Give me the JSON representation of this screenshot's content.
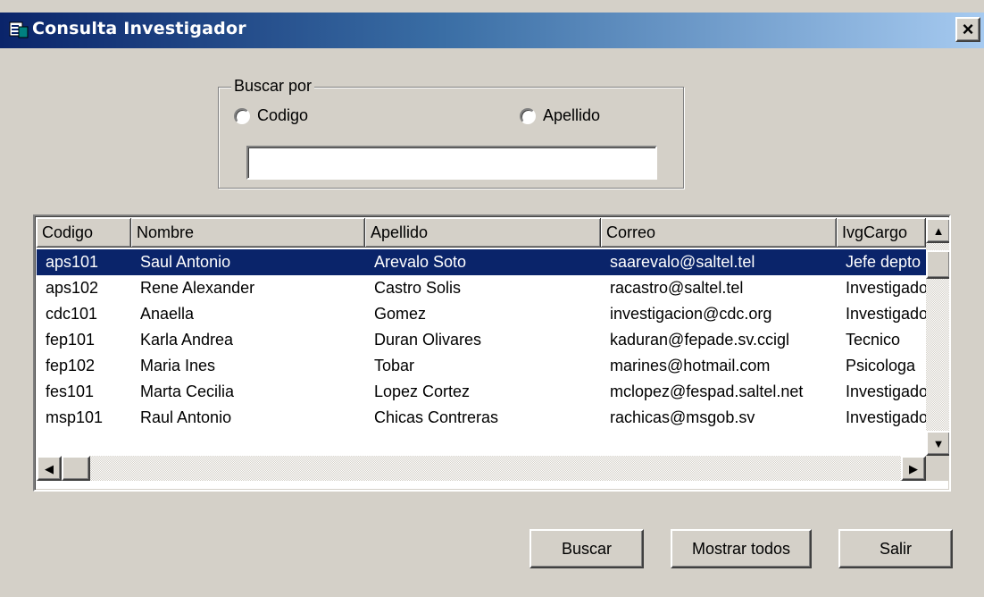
{
  "window": {
    "title": "Consulta Investigador",
    "icon": "app-window-icon",
    "close_glyph": "×"
  },
  "search": {
    "group_label": "Buscar por",
    "radio_codigo": "Codigo",
    "radio_apellido": "Apellido",
    "input_value": "",
    "input_placeholder": ""
  },
  "grid": {
    "columns": [
      "Codigo",
      "Nombre",
      "Apellido",
      "Correo",
      "IvgCargo"
    ],
    "rows": [
      {
        "codigo": "aps101",
        "nombre": "Saul Antonio",
        "apellido": "Arevalo Soto",
        "correo": "saarevalo@saltel.tel",
        "cargo": "Jefe depto"
      },
      {
        "codigo": "aps102",
        "nombre": "Rene Alexander",
        "apellido": "Castro Solis",
        "correo": "racastro@saltel.tel",
        "cargo": "Investigador"
      },
      {
        "codigo": "cdc101",
        "nombre": "Anaella",
        "apellido": "Gomez",
        "correo": "investigacion@cdc.org",
        "cargo": "Investigador"
      },
      {
        "codigo": "fep101",
        "nombre": "Karla Andrea",
        "apellido": "Duran Olivares",
        "correo": "kaduran@fepade.sv.ccigl",
        "cargo": "Tecnico"
      },
      {
        "codigo": "fep102",
        "nombre": "Maria Ines",
        "apellido": "Tobar",
        "correo": "marines@hotmail.com",
        "cargo": "Psicologa"
      },
      {
        "codigo": "fes101",
        "nombre": "Marta Cecilia",
        "apellido": "Lopez Cortez",
        "correo": "mclopez@fespad.saltel.net",
        "cargo": "Investigador"
      },
      {
        "codigo": "msp101",
        "nombre": "Raul Antonio",
        "apellido": "Chicas Contreras",
        "correo": "rachicas@msgob.sv",
        "cargo": "Investigador"
      }
    ],
    "selected_index": 0
  },
  "buttons": {
    "buscar": "Buscar",
    "mostrar_todos": "Mostrar todos",
    "salir": "Salir"
  },
  "colors": {
    "face": "#d4d0c8",
    "selection": "#0a246a",
    "titlebar_start": "#0a246a",
    "titlebar_end": "#a6caf0"
  }
}
